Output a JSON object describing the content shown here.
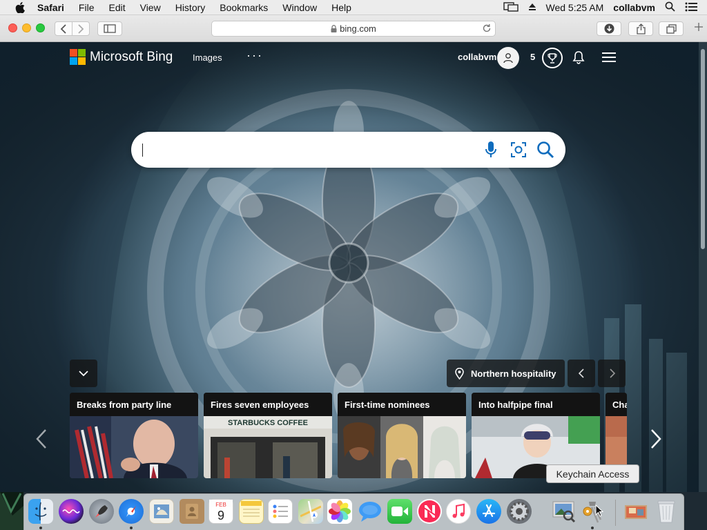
{
  "menubar": {
    "app": "Safari",
    "items": [
      "File",
      "Edit",
      "View",
      "History",
      "Bookmarks",
      "Window",
      "Help"
    ],
    "clock": "Wed 5:25 AM",
    "user": "collabvm"
  },
  "browser": {
    "url": "bing.com"
  },
  "bing": {
    "logo_text": "Microsoft Bing",
    "nav_images": "Images",
    "nav_more": "···",
    "username": "collabvm",
    "points": "5",
    "search_value": "",
    "location_label": "Northern hospitality",
    "cards": [
      {
        "title": "Breaks from party line"
      },
      {
        "title": "Fires seven employees",
        "sign": "STARBUCKS COFFEE"
      },
      {
        "title": "First-time nominees"
      },
      {
        "title": "Into halfpipe final"
      },
      {
        "title": "Cha"
      }
    ]
  },
  "dock": {
    "tooltip": "Keychain Access",
    "apps": [
      {
        "name": "finder-icon",
        "label": "Finder"
      },
      {
        "name": "siri-icon",
        "label": "Siri"
      },
      {
        "name": "launchpad-icon",
        "label": "Launchpad"
      },
      {
        "name": "safari-icon",
        "label": "Safari"
      },
      {
        "name": "mail-icon",
        "label": "Mail"
      },
      {
        "name": "contacts-icon",
        "label": "Contacts"
      },
      {
        "name": "calendar-icon",
        "label": "Calendar",
        "month": "FEB",
        "day": "9"
      },
      {
        "name": "notes-icon",
        "label": "Notes"
      },
      {
        "name": "reminders-icon",
        "label": "Reminders"
      },
      {
        "name": "maps-icon",
        "label": "Maps"
      },
      {
        "name": "photos-icon",
        "label": "Photos"
      },
      {
        "name": "messages-icon",
        "label": "Messages"
      },
      {
        "name": "facetime-icon",
        "label": "FaceTime"
      },
      {
        "name": "news-icon",
        "label": "News"
      },
      {
        "name": "music-icon",
        "label": "Music"
      },
      {
        "name": "app-store-icon",
        "label": "App Store"
      },
      {
        "name": "system-preferences-icon",
        "label": "System Preferences"
      },
      {
        "name": "preview-icon",
        "label": "Preview"
      },
      {
        "name": "keychain-access-icon",
        "label": "Keychain Access"
      },
      {
        "name": "downloads-stack-icon",
        "label": "Downloads"
      },
      {
        "name": "trash-icon",
        "label": "Trash"
      }
    ]
  },
  "colors": {
    "bing_red": "#f25022",
    "bing_green": "#7fba00",
    "bing_blue": "#00a4ef",
    "bing_yellow": "#ffb900",
    "search_icon_blue": "#0f6cbd"
  }
}
